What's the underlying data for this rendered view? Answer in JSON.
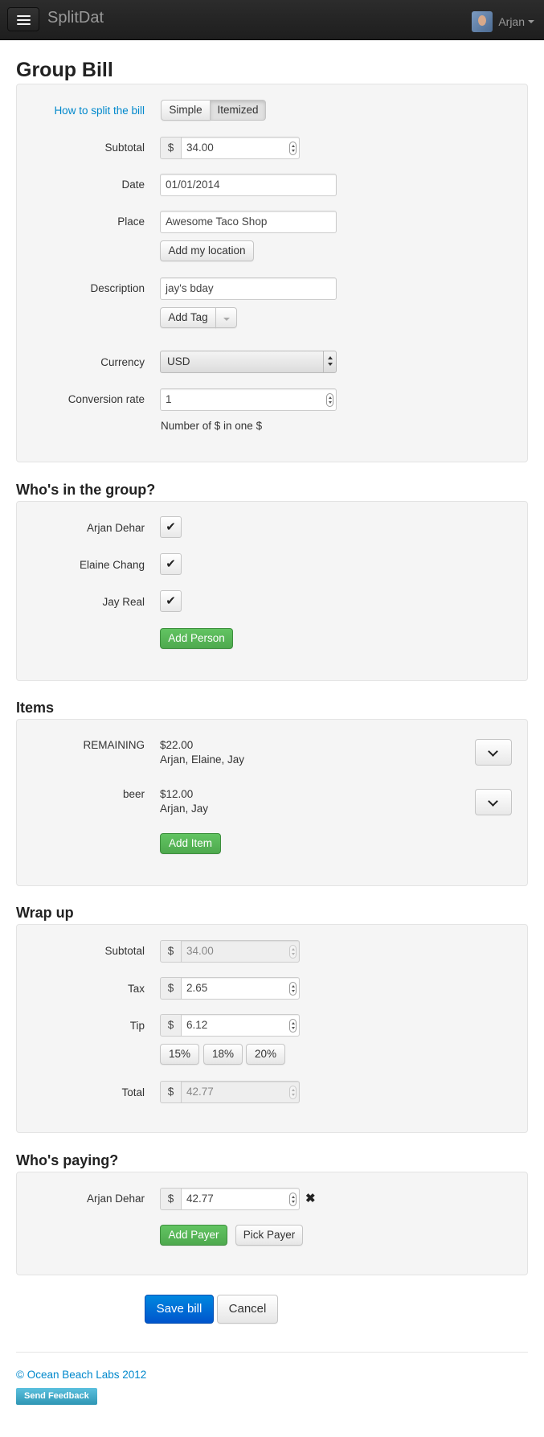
{
  "nav": {
    "brand": "SplitDat",
    "user_name": "Arjan"
  },
  "page_title": "Group Bill",
  "bill": {
    "split_label": "How to split the bill",
    "split_options": [
      "Simple",
      "Itemized"
    ],
    "split_selected": "Itemized",
    "subtotal_label": "Subtotal",
    "currency_symbol": "$",
    "subtotal_value": "34.00",
    "date_label": "Date",
    "date_value": "01/01/2014",
    "place_label": "Place",
    "place_value": "Awesome Taco Shop",
    "add_location_label": "Add my location",
    "description_label": "Description",
    "description_value": "jay's bday",
    "add_tag_label": "Add Tag",
    "currency_label": "Currency",
    "currency_value": "USD",
    "conversion_label": "Conversion rate",
    "conversion_value": "1",
    "conversion_help": "Number of $ in one $"
  },
  "group": {
    "heading": "Who's in the group?",
    "members": [
      {
        "name": "Arjan Dehar",
        "checked": true
      },
      {
        "name": "Elaine Chang",
        "checked": true
      },
      {
        "name": "Jay Real",
        "checked": true
      }
    ],
    "check_glyph": "✔",
    "add_person_label": "Add Person"
  },
  "items": {
    "heading": "Items",
    "list": [
      {
        "name": "REMAINING",
        "amount": "$22.00",
        "people": "Arjan, Elaine, Jay"
      },
      {
        "name": "beer",
        "amount": "$12.00",
        "people": "Arjan, Jay"
      }
    ],
    "add_item_label": "Add Item"
  },
  "wrapup": {
    "heading": "Wrap up",
    "subtotal_label": "Subtotal",
    "subtotal_value": "34.00",
    "tax_label": "Tax",
    "tax_value": "2.65",
    "tip_label": "Tip",
    "tip_value": "6.12",
    "tip_presets": [
      "15%",
      "18%",
      "20%"
    ],
    "total_label": "Total",
    "total_value": "42.77"
  },
  "paying": {
    "heading": "Who's paying?",
    "payer_name": "Arjan Dehar",
    "payer_amount": "42.77",
    "remove_glyph": "✖",
    "add_payer_label": "Add Payer",
    "pick_payer_label": "Pick Payer"
  },
  "actions": {
    "save_label": "Save bill",
    "cancel_label": "Cancel"
  },
  "footer": {
    "copyright": "© Ocean Beach Labs 2012",
    "feedback_label": "Send Feedback"
  }
}
